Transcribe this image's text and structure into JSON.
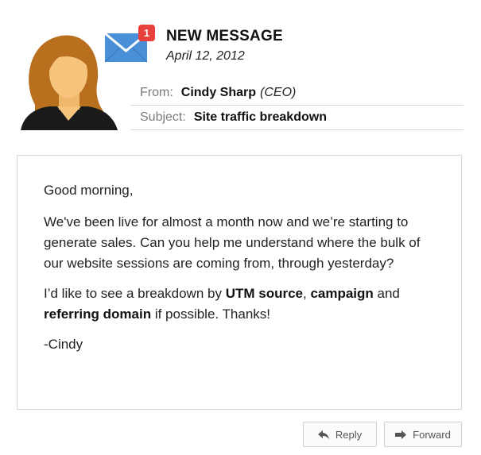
{
  "header": {
    "badge_count": "1",
    "title": "NEW MESSAGE",
    "date": "April 12, 2012"
  },
  "meta": {
    "from_label": "From:",
    "from_name": "Cindy Sharp",
    "from_role": "(CEO)",
    "subject_label": "Subject:",
    "subject_value": "Site traffic breakdown"
  },
  "body": {
    "greeting": "Good morning,",
    "paragraph1": "We've been live for almost a month now and we’re starting to generate sales. Can you help me understand where the bulk of our website sessions are coming from, through yesterday?",
    "p2_part1": "I’d like to see a breakdown by ",
    "p2_bold1": "UTM source",
    "p2_part2": ", ",
    "p2_bold2": "campaign",
    "p2_part3": " and ",
    "p2_bold3": "referring domain",
    "p2_part4": " if possible. Thanks!",
    "signoff": "-Cindy"
  },
  "actions": {
    "reply_label": "Reply",
    "forward_label": "Forward"
  },
  "icons": {
    "avatar": "woman-avatar",
    "envelope": "envelope-icon",
    "reply": "reply-arrow-icon",
    "forward": "forward-arrow-icon"
  },
  "colors": {
    "envelope_blue": "#4a90d9",
    "badge_red": "#e8403c",
    "hair": "#b8701f",
    "skin": "#f7c47e",
    "shirt": "#1a1a1a"
  }
}
